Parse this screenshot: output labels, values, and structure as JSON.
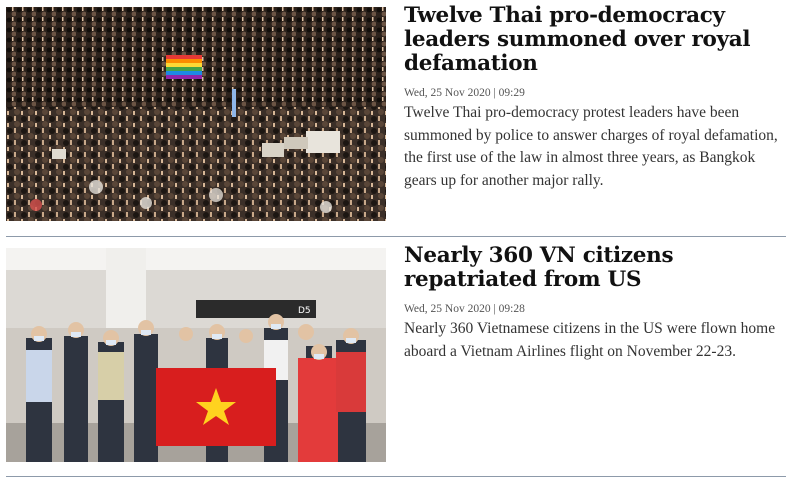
{
  "articles": [
    {
      "image_alt": "crowd-of-protesters",
      "headline": "Twelve Thai pro-democracy leaders summoned over royal defamation",
      "date": "Wed, 25 Nov 2020 | 09:29",
      "summary": "Twelve Thai pro-democracy protest leaders have been summoned by police to answer charges of royal defamation, the first use of the law in almost three years, as Bangkok gears up for another major rally."
    },
    {
      "image_alt": "group-with-vietnam-flag-at-airport",
      "headline": "Nearly 360 VN citizens repatriated from US",
      "date": "Wed, 25 Nov 2020 | 09:28",
      "summary": "Nearly 360 Vietnamese citizens in the US were flown home aboard a Vietnam Airlines flight on November 22-23.",
      "image_sign": "D5"
    }
  ]
}
